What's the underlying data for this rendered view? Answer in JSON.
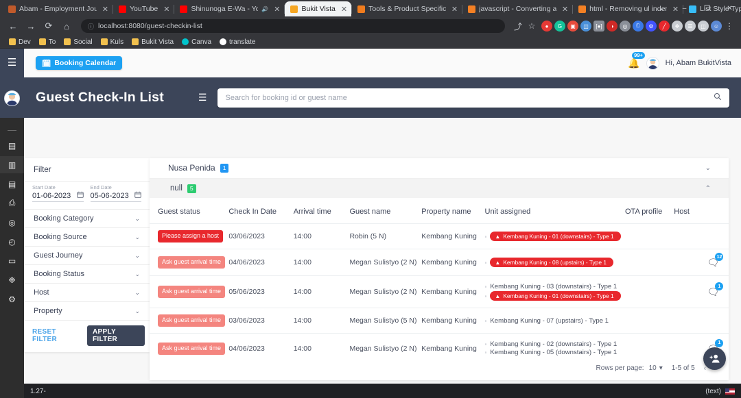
{
  "browser": {
    "tabs": [
      {
        "label": "Abam - Employment Journ",
        "favicon_color": "#c05a2b",
        "active": false,
        "close": "✕"
      },
      {
        "label": "YouTube",
        "favicon_color": "#ff0000",
        "active": false,
        "close": "✕"
      },
      {
        "label": "Shinunoga E-Wa - You",
        "favicon_color": "#ff0000",
        "active": false,
        "close": "✕",
        "muted_icon": "🔊"
      },
      {
        "label": "Bukit Vista",
        "favicon_color": "#f5a623",
        "active": true,
        "close": "✕"
      },
      {
        "label": "Tools & Product Specifica",
        "favicon_color": "#f07c1e",
        "active": false,
        "close": "✕"
      },
      {
        "label": "javascript - Converting an",
        "favicon_color": "#f48024",
        "active": false,
        "close": "✕"
      },
      {
        "label": "html - Removing ul indent",
        "favicon_color": "#f48024",
        "active": false,
        "close": "✕"
      },
      {
        "label": "List Style Type - Tailwind C",
        "favicon_color": "#38bdf8",
        "active": false,
        "close": "✕"
      }
    ],
    "new_tab": "+",
    "window_buttons": [
      "⌄",
      "–",
      "❐",
      "✕"
    ],
    "nav": {
      "back": "←",
      "forward": "→",
      "reload": "⟳",
      "home": "⌂"
    },
    "url": "localhost:8080/guest-checkin-list",
    "url_info_icon": "ⓘ",
    "omnibar_icons": {
      "share": "⤴",
      "star": "☆",
      "menu": "⋮"
    },
    "extensions": [
      {
        "name": "adblock-extension-icon",
        "color": "#e53935",
        "glyph": "●"
      },
      {
        "name": "grammarly-extension-icon",
        "color": "#15c39a",
        "glyph": "G"
      },
      {
        "name": "screenshot-extension-icon",
        "color": "#e74c3c",
        "glyph": "▣"
      },
      {
        "name": "color-picker-extension-icon",
        "color": "#4a90d9",
        "glyph": "◫"
      },
      {
        "name": "bracket-extension-icon",
        "color": "#8a8f98",
        "glyph": "[●]"
      },
      {
        "name": "bitwarden-extension-icon",
        "color": "#cf2a27",
        "glyph": "◑"
      },
      {
        "name": "loom-extension-icon",
        "color": "#8a8f98",
        "glyph": "◎"
      },
      {
        "name": "wappalyzer-extension-icon",
        "color": "#3a79e6",
        "glyph": "ඞ"
      },
      {
        "name": "settings-extension-icon",
        "color": "#4253ff",
        "glyph": "⚙"
      },
      {
        "name": "highlight-extension-icon",
        "color": "#e8282d",
        "glyph": "╱"
      },
      {
        "name": "puzzle-extensions-icon",
        "color": "#c8ccd1",
        "glyph": "❖"
      },
      {
        "name": "reading-list-icon",
        "color": "#c8ccd1",
        "glyph": "☰"
      },
      {
        "name": "sidepanel-icon",
        "color": "#c8ccd1",
        "glyph": "◫"
      },
      {
        "name": "profile-avatar-icon",
        "color": "#5c8ad6",
        "glyph": "☺"
      }
    ],
    "bookmarks": [
      {
        "label": "Dev",
        "type": "folder"
      },
      {
        "label": "To",
        "type": "folder"
      },
      {
        "label": "Social",
        "type": "folder"
      },
      {
        "label": "Kuls",
        "type": "folder"
      },
      {
        "label": "Bukit Vista",
        "type": "folder"
      },
      {
        "label": "Canva",
        "type": "canva"
      },
      {
        "label": "translate",
        "type": "gt"
      }
    ]
  },
  "app": {
    "rail": {
      "hamburger_icon": "☰",
      "avatar_icon": "👤",
      "items": [
        {
          "name": "sidebar-item-dashboard",
          "glyph": "▤",
          "selected": false
        },
        {
          "name": "sidebar-item-checkin-list",
          "glyph": "▥",
          "selected": true
        },
        {
          "name": "sidebar-item-bookings",
          "glyph": "▤",
          "selected": false
        },
        {
          "name": "sidebar-item-reports",
          "glyph": "⎙",
          "selected": false
        },
        {
          "name": "sidebar-item-support",
          "glyph": "◎",
          "selected": false
        },
        {
          "name": "sidebar-item-history",
          "glyph": "◴",
          "selected": false
        },
        {
          "name": "sidebar-item-payments",
          "glyph": "▭",
          "selected": false
        },
        {
          "name": "sidebar-item-integrations",
          "glyph": "❉",
          "selected": false
        },
        {
          "name": "sidebar-item-settings",
          "glyph": "⚙",
          "selected": false
        }
      ]
    },
    "topbar": {
      "booking_calendar_label": "Booking Calendar",
      "booking_calendar_icon": "🗓",
      "bell_icon": "🔔",
      "bell_badge": "99+",
      "user_avatar_icon": "👤",
      "greeting": "Hi, Abam BukitVista"
    },
    "header": {
      "title": "Guest Check-In List",
      "menu_icon": "☰",
      "search_placeholder": "Search for booking id or guest name",
      "search_value": "",
      "search_icon": "🔍"
    },
    "filter": {
      "title": "Filter",
      "start_date": {
        "label": "Start Date",
        "value": "01-06-2023",
        "icon": "🗓"
      },
      "end_date": {
        "label": "End Date",
        "value": "05-06-2023",
        "icon": "🗓"
      },
      "sections": [
        {
          "label": "Booking Category",
          "chevron": "⌄"
        },
        {
          "label": "Booking Source",
          "chevron": "⌄"
        },
        {
          "label": "Guest Journey",
          "chevron": "⌄"
        },
        {
          "label": "Booking Status",
          "chevron": "⌄"
        },
        {
          "label": "Host",
          "chevron": "⌄"
        },
        {
          "label": "Property",
          "chevron": "⌄"
        }
      ],
      "reset_label": "RESET FILTER",
      "apply_label": "APPLY FILTER"
    },
    "content": {
      "group": {
        "name": "Nusa Penida",
        "count": "1",
        "chevron": "⌄"
      },
      "subgroup": {
        "name": "null",
        "count": "5",
        "chevron": "⌃"
      },
      "columns": [
        "Guest status",
        "Check In Date",
        "Arrival time",
        "Guest name",
        "Property name",
        "Unit assigned",
        "OTA profile",
        "Host",
        ""
      ],
      "rows": [
        {
          "status": "Please assign a host",
          "status_style": "assign",
          "check_in_date": "03/06/2023",
          "arrival_time": "14:00",
          "guest_name": "Robin (5 N)",
          "property_name": "Kembang Kuning",
          "units": [
            {
              "text": "Kembang Kuning - 01 (downstairs) - Type 1",
              "alert": true
            }
          ],
          "ota_profile": "",
          "host": "",
          "chat_badge": ""
        },
        {
          "status": "Ask guest arrival time",
          "status_style": "ask",
          "check_in_date": "04/06/2023",
          "arrival_time": "14:00",
          "guest_name": "Megan Sulistyo (2 N)",
          "property_name": "Kembang Kuning",
          "units": [
            {
              "text": "Kembang Kuning - 08 (upstairs) - Type 1",
              "alert": true
            }
          ],
          "ota_profile": "",
          "host": "",
          "chat_badge": "12"
        },
        {
          "status": "Ask guest arrival time",
          "status_style": "ask",
          "check_in_date": "05/06/2023",
          "arrival_time": "14:00",
          "guest_name": "Megan Sulistyo (2 N)",
          "property_name": "Kembang Kuning",
          "units": [
            {
              "text": "Kembang Kuning - 03 (downstairs) - Type 1",
              "alert": false
            },
            {
              "text": "Kembang Kuning - 01 (downstairs) - Type 1",
              "alert": true
            }
          ],
          "ota_profile": "",
          "host": "",
          "chat_badge": "1"
        },
        {
          "status": "Ask guest arrival time",
          "status_style": "ask",
          "check_in_date": "03/06/2023",
          "arrival_time": "14:00",
          "guest_name": "Megan Sulistyo (5 N)",
          "property_name": "Kembang Kuning",
          "units": [
            {
              "text": "Kembang Kuning - 07 (upstairs) - Type 1",
              "alert": false
            }
          ],
          "ota_profile": "",
          "host": "",
          "chat_badge": ""
        },
        {
          "status": "Ask guest arrival time",
          "status_style": "ask",
          "check_in_date": "04/06/2023",
          "arrival_time": "14:00",
          "guest_name": "Megan Sulistyo (2 N)",
          "property_name": "Kembang Kuning",
          "units": [
            {
              "text": "Kembang Kuning - 02 (downstairs) - Type 1",
              "alert": false
            },
            {
              "text": "Kembang Kuning - 05 (downstairs) - Type 1",
              "alert": false
            }
          ],
          "ota_profile": "",
          "host": "",
          "chat_badge": "1"
        }
      ],
      "pager": {
        "rows_per_page_label": "Rows per page:",
        "rows_per_page_value": "10",
        "dropdown_icon": "▾",
        "range_label": "1-5 of 5",
        "prev_icon": "‹",
        "next_icon": "›"
      },
      "fab_icon": "\u0000",
      "fab_name": "add-guest-fab"
    },
    "statusbar": {
      "left": "1.27-",
      "right": "(text)"
    }
  },
  "colors": {
    "accent_blue": "#1da1f2",
    "danger_red": "#e8282d",
    "warn_salmon": "#f4857f",
    "green": "#2ecc71",
    "navy": "#3c4559"
  }
}
